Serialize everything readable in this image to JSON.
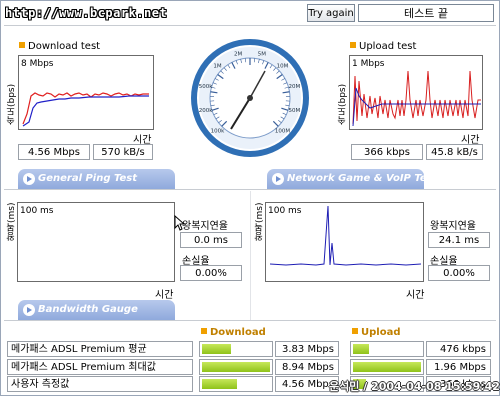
{
  "header": {
    "url": "http://www.bcpark.net",
    "try_again_label": "Try again",
    "status_text": "테스트 끝"
  },
  "download": {
    "title": "Download test",
    "y_label": "속도(bps)",
    "y_max": "8 Mbps",
    "x_label": "시간",
    "mbps": "4.56 Mbps",
    "kbs": "570 kB/s"
  },
  "upload": {
    "title": "Upload test",
    "y_label": "속도(bps)",
    "y_max": "1 Mbps",
    "x_label": "시간",
    "kbps": "366 kbps",
    "kbs": "45.8 kB/s"
  },
  "gauge": {
    "ticks": [
      "100k",
      "200k",
      "500k",
      "1M",
      "2M",
      "5M",
      "10M",
      "20M",
      "50M",
      "100M"
    ],
    "needle_value": "4.56 Mbps"
  },
  "tabs": {
    "ping": "General Ping Test",
    "game": "Network Game & VoIP Test",
    "bandwidth": "Bandwidth Gauge"
  },
  "ping": {
    "y_label": "왕복(ms)",
    "y_max": "100 ms",
    "x_label": "시간",
    "rtt_label": "왕복지연율",
    "rtt_value": "0.0 ms",
    "loss_label": "손실율",
    "loss_value": "0.00%"
  },
  "game": {
    "y_label": "왕복(ms)",
    "y_max": "100 ms",
    "x_label": "시간",
    "rtt_label": "왕복지연율",
    "rtt_value": "24.1 ms",
    "loss_label": "손실율",
    "loss_value": "0.00%"
  },
  "bandwidth": {
    "download_header": "Download",
    "upload_header": "Upload",
    "rows": [
      {
        "name": "메가패스 ADSL Premium 평균",
        "download": "3.83 Mbps",
        "download_fill": 0.43,
        "upload": "476 kbps",
        "upload_fill": 0.24
      },
      {
        "name": "메가패스 ADSL Premium 최대값",
        "download": "8.94 Mbps",
        "download_fill": 1.0,
        "upload": "1.96 Mbps",
        "upload_fill": 1.0
      },
      {
        "name": "사용자 측정값",
        "download": "4.56 Mbps",
        "download_fill": 0.51,
        "upload": "366 kbps",
        "upload_fill": 0.19
      }
    ]
  },
  "stamp": "운석민 / 2004-04-08 15:59:42",
  "colors": {
    "tab": "#8fa9dc",
    "accent": "#f0a000",
    "bar": "#9ccc2a",
    "gauge": "#2f6fb5"
  }
}
